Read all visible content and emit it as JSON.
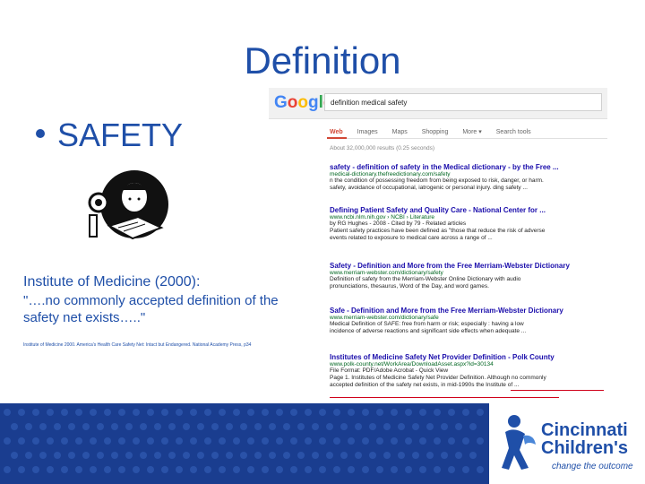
{
  "slide": {
    "title": "Definition",
    "bullet": "SAFETY",
    "iom_heading": "Institute of Medicine (2000):",
    "quote_line1": "\"….no commonly accepted definition of the",
    "quote_line2": "safety net exists…..\"",
    "citation": "Institute of Medicine 2000. America's Health Care Safety Net: Intact but Endangered. National Academy Press, p34"
  },
  "search": {
    "logo": "Google",
    "query": "definition medical safety",
    "tabs": [
      "Web",
      "Images",
      "Maps",
      "Shopping",
      "More ▾",
      "Search tools"
    ],
    "active_tab": "Web",
    "stats": "About 32,000,000 results (0.25 seconds)",
    "results": [
      {
        "title": "safety - definition of safety in the Medical dictionary - by the Free ...",
        "url": "medical-dictionary.thefreedictionary.com/safety",
        "snippet1": "n the condition of possessing freedom from being exposed to risk, danger, or harm.",
        "snippet2": "safety, avoidance of occupational, iatrogenic or personal injury. ding safety ..."
      },
      {
        "title": "Defining Patient Safety and Quality Care - National Center for ...",
        "url": "www.ncbi.nlm.nih.gov › NCBI › Literature",
        "snippet1": "by RG Hughes - 2008 - Cited by 79 - Related articles",
        "snippet2": "Patient safety practices have been defined as \"those that reduce the risk of adverse",
        "snippet3": "events related to exposure to medical care across a range of ..."
      },
      {
        "title": "Safety - Definition and More from the Free Merriam-Webster Dictionary",
        "url": "www.merriam-webster.com/dictionary/safety",
        "snippet1": "Definition of safety from the Merriam-Webster Online Dictionary with audio",
        "snippet2": "pronunciations, thesaurus, Word of the Day, and word games."
      },
      {
        "title": "Safe - Definition and More from the Free Merriam-Webster Dictionary",
        "url": "www.merriam-webster.com/dictionary/safe",
        "snippet1": "Medical Definition of SAFE: free from harm or risk; especially : having a low",
        "snippet2": "incidence of adverse reactions and significant side effects when adequate ..."
      },
      {
        "title": "Institutes of Medicine Safety Net Provider Definition - Polk County",
        "url": "www.polk-county.net/WorkArea/DownloadAsset.aspx?id=30134",
        "snippet1": "File Format: PDF/Adobe Acrobat - Quick View",
        "snippet2": "Page 1. Institutes of Medicine Safety Net Provider Definition. Although no commonly",
        "snippet3": "accepted definition of the safety net exists, in mid-1990s the Institute of ..."
      }
    ]
  },
  "branding": {
    "name_line1": "Cincinnati",
    "name_line2": "Children's",
    "tagline": "change the outcome",
    "accent_color": "#1f4fa8",
    "footer_color": "#1a3d8f"
  }
}
